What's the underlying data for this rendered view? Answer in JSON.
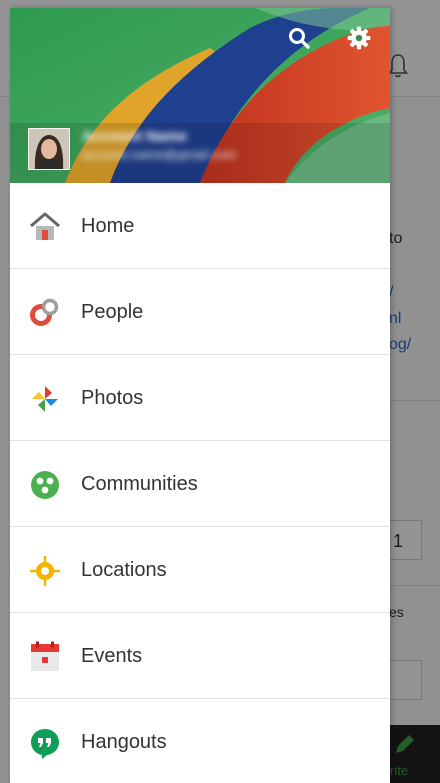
{
  "background_app": {
    "lines": [
      "to",
      "/",
      "nl",
      "og/",
      "1",
      "es",
      "rite"
    ]
  },
  "drawer": {
    "header": {
      "search_icon": "search-icon",
      "settings_icon": "gear-icon",
      "account_name": "Account Name",
      "account_email": "account.name@gmail.com"
    },
    "items": [
      {
        "label": "Home",
        "icon": "home-icon"
      },
      {
        "label": "People",
        "icon": "people-icon"
      },
      {
        "label": "Photos",
        "icon": "photos-icon"
      },
      {
        "label": "Communities",
        "icon": "communities-icon"
      },
      {
        "label": "Locations",
        "icon": "locations-icon"
      },
      {
        "label": "Events",
        "icon": "events-icon"
      },
      {
        "label": "Hangouts",
        "icon": "hangouts-icon"
      }
    ]
  },
  "colors": {
    "home_red": "#dd4b39",
    "people_red": "#dd4b39",
    "communities_green": "#4caf50",
    "locations_yellow": "#f5b400",
    "events_red": "#e53935",
    "hangouts_green": "#0f9d58",
    "header_green": "#3f9b5a"
  }
}
